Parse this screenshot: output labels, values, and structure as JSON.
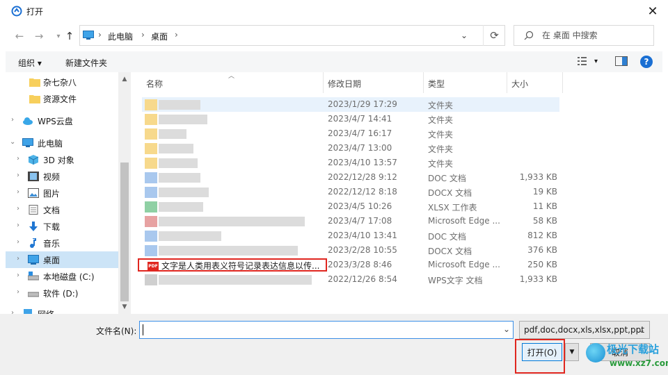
{
  "window": {
    "title": "打开"
  },
  "address": {
    "crumbs": [
      "此电脑",
      "桌面"
    ]
  },
  "search": {
    "placeholder": "在 桌面 中搜索"
  },
  "toolbar": {
    "organize": "组织 ▾",
    "new_folder": "新建文件夹"
  },
  "sidebar": {
    "items": [
      {
        "label": "杂七杂八",
        "icon": "folder-icon"
      },
      {
        "label": "资源文件",
        "icon": "folder-icon"
      },
      {
        "label": "WPS云盘",
        "icon": "cloud-icon"
      },
      {
        "label": "此电脑",
        "icon": "computer-icon"
      },
      {
        "label": "3D 对象",
        "icon": "3d-objects-icon"
      },
      {
        "label": "视频",
        "icon": "video-icon"
      },
      {
        "label": "图片",
        "icon": "pictures-icon"
      },
      {
        "label": "文档",
        "icon": "documents-icon"
      },
      {
        "label": "下载",
        "icon": "download-icon"
      },
      {
        "label": "音乐",
        "icon": "music-icon"
      },
      {
        "label": "桌面",
        "icon": "desktop-icon",
        "selected": true
      },
      {
        "label": "本地磁盘 (C:)",
        "icon": "drive-icon"
      },
      {
        "label": "软件 (D:)",
        "icon": "drive-icon"
      },
      {
        "label": "网络",
        "icon": "network-icon"
      }
    ]
  },
  "columns": {
    "name": "名称",
    "date": "修改日期",
    "type": "类型",
    "size": "大小"
  },
  "files": [
    {
      "date": "2023/1/29 17:29",
      "type": "文件夹",
      "size": ""
    },
    {
      "date": "2023/4/7 14:41",
      "type": "文件夹",
      "size": ""
    },
    {
      "date": "2023/4/7 16:17",
      "type": "文件夹",
      "size": ""
    },
    {
      "date": "2023/4/7 13:00",
      "type": "文件夹",
      "size": ""
    },
    {
      "date": "2023/4/10 13:57",
      "type": "文件夹",
      "size": ""
    },
    {
      "date": "2022/12/28 9:12",
      "type": "DOC 文档",
      "size": "1,933 KB"
    },
    {
      "date": "2022/12/12 8:18",
      "type": "DOCX 文档",
      "size": "19 KB"
    },
    {
      "date": "2023/4/5 10:26",
      "type": "XLSX 工作表",
      "size": "11 KB"
    },
    {
      "date": "2023/4/7 17:08",
      "type": "Microsoft Edge ...",
      "size": "58 KB"
    },
    {
      "date": "2023/4/10 13:41",
      "type": "DOC 文档",
      "size": "812 KB"
    },
    {
      "date": "2023/2/28 10:55",
      "type": "DOCX 文档",
      "size": "376 KB"
    },
    {
      "name": "文字是人类用表义符号记录表达信息以传...",
      "date": "2023/3/28 8:46",
      "type": "Microsoft Edge ...",
      "size": "250 KB"
    },
    {
      "date": "2022/12/26 8:54",
      "type": "WPS文字 文档",
      "size": "1,933 KB"
    }
  ],
  "bottom": {
    "filename_label": "文件名(N):",
    "filename_value": "",
    "filetype": "pdf,doc,docx,xls,xlsx,ppt,ppt",
    "open": "打开(O)",
    "cancel": "取消"
  },
  "watermark": {
    "brand": "极光下载站",
    "url": "www.xz7.com"
  },
  "colors": {
    "accent": "#0078d7",
    "highlight_box": "#e0261f",
    "selected_bg": "#cce4f7"
  }
}
